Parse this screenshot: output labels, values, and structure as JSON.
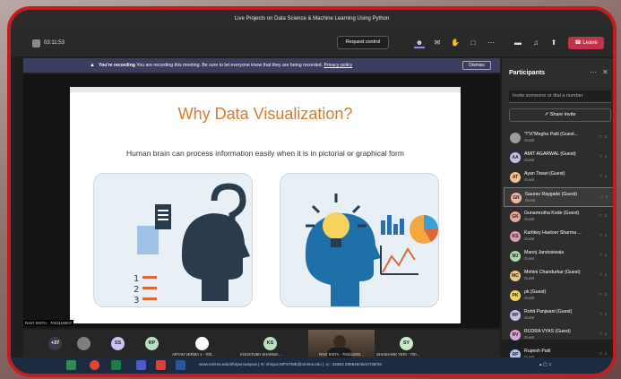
{
  "window": {
    "title": "Live Projects on Data Science & Machine Learning Using Python"
  },
  "toolbar": {
    "timer": "03:11:53",
    "request_control_label": "Request control",
    "leave_label": "Leave",
    "icons": [
      "participants-icon",
      "chat-icon",
      "raise-hand-icon",
      "rooms-icon",
      "more-icon",
      "camera-icon",
      "mic-icon",
      "share-icon",
      "phone-icon"
    ]
  },
  "recording_banner": {
    "bold": "You're recording",
    "text": "You are recording this meeting. Be sure to let everyone know that they are being recorded.",
    "link": "Privacy policy",
    "dismiss_label": "Dismiss"
  },
  "slide": {
    "title": "Why Data Visualization?",
    "subtitle": "Human brain can process information easily when it is in pictorial or graphical form"
  },
  "presenter_label": "RAVI SISTA - 7041118037",
  "participants": {
    "title": "Participants",
    "search_placeholder": "Invite someone or dial a number",
    "share_invite_label": "Share invite",
    "items": [
      {
        "initials": "",
        "name": "\"\\\"\\\\\\\"Megha Patil (Guest...",
        "role": "Guest",
        "color": "#9b9b9b"
      },
      {
        "initials": "AA",
        "name": "AMIT AGARWAL (Guest)",
        "role": "Guest",
        "color": "#b9c4ea"
      },
      {
        "initials": "AT",
        "name": "Ayan Tiwari (Guest)",
        "role": "Guest",
        "color": "#f2c18b"
      },
      {
        "initials": "GR",
        "name": "Gaurav Raygade (Guest)",
        "role": "Guest",
        "color": "#f0b99e",
        "selected": true
      },
      {
        "initials": "GK",
        "name": "Gunamrutha Kode (Guest)",
        "role": "Guest",
        "color": "#e8a4a0"
      },
      {
        "initials": "KS",
        "name": "Kartikey Hastoer Sharma ...",
        "role": "Guest",
        "color": "#d99ab3"
      },
      {
        "initials": "MJ",
        "name": "Manoj Jandosiwala",
        "role": "Guest",
        "color": "#a8d8b0"
      },
      {
        "initials": "MC",
        "name": "Mohini Chandurkar (Guest)",
        "role": "Guest",
        "color": "#f1c48a"
      },
      {
        "initials": "PK",
        "name": "pk (Guest)",
        "role": "Guest",
        "color": "#f4d35e"
      },
      {
        "initials": "RP",
        "name": "Rohit Panjwani (Guest)",
        "role": "Guest",
        "color": "#b9c4ea"
      },
      {
        "initials": "RV",
        "name": "RUDRA VYAS (Guest)",
        "role": "Guest",
        "color": "#d6a6d8"
      },
      {
        "initials": "RP",
        "name": "Rupesh Patil",
        "role": "Guest",
        "color": "#b9c4ea"
      }
    ]
  },
  "video_strip": {
    "overflow_badge": "+37",
    "tiles": [
      {
        "initials": "",
        "label": "",
        "color": "#7e7e7e"
      },
      {
        "initials": "SS",
        "label": "",
        "color": "#c8c3f2"
      },
      {
        "initials": "RP",
        "label": "",
        "color": "#b9e0c0"
      },
      {
        "initials": "",
        "label": "ARYAN VERMA 1 - 700...",
        "color": "#ffffff"
      },
      {
        "initials": "KS",
        "label": "KOUSTUBH SHARMA ...",
        "color": "#b9e0c0"
      },
      {
        "initials": "",
        "label": "RAVI SISTA - 704111803...",
        "color": ""
      },
      {
        "initials": "SY",
        "label": "SHASHANK YERI - 700...",
        "color": "#c8ecc9"
      }
    ]
  },
  "taskbar": {
    "address_text": "www.nmims.edu/shirpurcampus | ✉: shirpur.MPSTME@nmims.edu | ☏: 02563 295545/46/47/48/49"
  }
}
